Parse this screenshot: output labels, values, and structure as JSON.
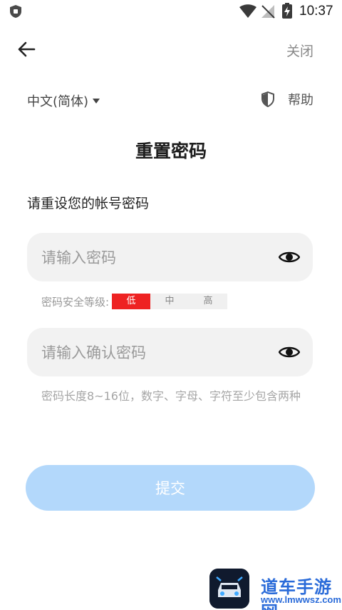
{
  "status_bar": {
    "time": "10:37",
    "icons": [
      "app-shield-icon",
      "wifi-icon",
      "no-signal-icon",
      "battery-charging-icon"
    ]
  },
  "nav": {
    "back_icon": "arrow-left-icon",
    "close_label": "关闭"
  },
  "language": {
    "selected": "中文(简体)"
  },
  "help": {
    "icon": "shield-icon",
    "label": "帮助"
  },
  "page": {
    "title": "重置密码",
    "subtitle": "请重设您的帐号密码"
  },
  "password_field": {
    "placeholder": "请输入密码",
    "value": "",
    "toggle_icon": "eye-icon"
  },
  "strength": {
    "label": "密码安全等级:",
    "levels": [
      "低",
      "中",
      "高"
    ],
    "active_level": "低",
    "active_color": "#ee2222"
  },
  "confirm_field": {
    "placeholder": "请输入确认密码",
    "value": "",
    "toggle_icon": "eye-icon"
  },
  "hint": "密码长度8~16位，数字、字母、字符至少包含两种",
  "submit": {
    "label": "提交",
    "color": "#b3d8fb",
    "enabled": false
  },
  "watermark": {
    "title": "道车手游网",
    "url": "www.lmwwsz.com"
  }
}
